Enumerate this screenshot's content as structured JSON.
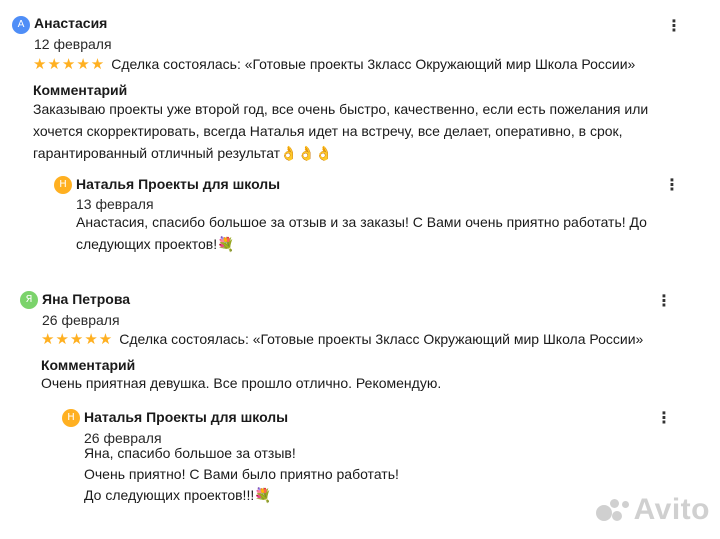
{
  "colors": {
    "star": "#ffb021",
    "avatar_blue": "#4f8ef7",
    "avatar_green": "#7bd36b",
    "avatar_orange": "#ffb021",
    "watermark": "#c8c8c8"
  },
  "reviews": [
    {
      "avatar_letter": "А",
      "author": "Анастасия",
      "date": "12 февраля",
      "stars": "★★★★★",
      "deal": "Сделка состоялась: «Готовые проекты 3класс Окружающий мир Школа России»",
      "comment_label": "Комментарий",
      "comment_lines": [
        "Заказываю проекты уже второй год, все очень быстро, качественно, если есть пожелания или",
        "хочется скорректировать, всегда Наталья идет на встречу, все делает, оперативно, в срок,",
        "гарантированный отличный результат👌👌👌"
      ],
      "reply": {
        "avatar_letter": "Н",
        "author": "Наталья Проекты для школы",
        "date": "13 февраля",
        "lines": [
          "Анастасия, спасибо большое за отзыв и за заказы! С Вами очень приятно работать! До",
          "следующих проектов!💐"
        ]
      }
    },
    {
      "avatar_letter": "Я",
      "author": "Яна Петрова",
      "date": "26 февраля",
      "stars": "★★★★★",
      "deal": "Сделка состоялась: «Готовые проекты 3класс Окружающий мир Школа России»",
      "comment_label": "Комментарий",
      "comment_lines": [
        "Очень приятная девушка. Все прошло отлично. Рекомендую."
      ],
      "reply": {
        "avatar_letter": "Н",
        "author": "Наталья Проекты для школы",
        "date": "26 февраля",
        "lines": [
          "Яна, спасибо большое за отзыв!",
          "Очень приятно! С Вами было приятно работать!",
          "До следующих проектов!!!💐"
        ]
      }
    }
  ],
  "menu_glyph": "⋮",
  "watermark_text": "Avito"
}
